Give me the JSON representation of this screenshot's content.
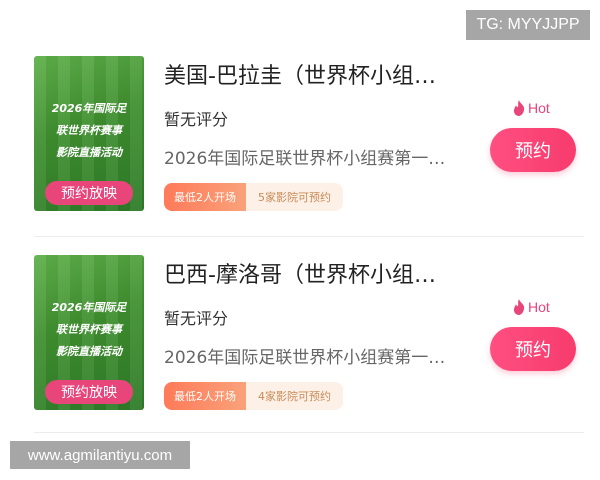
{
  "watermarks": {
    "tg": "TG: MYYJJPP",
    "site": "www.agmilantiyu.com"
  },
  "events": [
    {
      "poster_lines": [
        "2026年国际足",
        "联世界杯赛事",
        "影院直播活动"
      ],
      "poster_button": "预约放映",
      "title": "美国-巴拉圭（世界杯小组…",
      "rating": "暂无评分",
      "description": "2026年国际足联世界杯小组赛第一…",
      "min_tag": "最低2人开场",
      "cinema_tag": "5家影院可预约",
      "hot_label": "Hot",
      "book_label": "预约"
    },
    {
      "poster_lines": [
        "2026年国际足",
        "联世界杯赛事",
        "影院直播活动"
      ],
      "poster_button": "预约放映",
      "title": "巴西-摩洛哥（世界杯小组…",
      "rating": "暂无评分",
      "description": "2026年国际足联世界杯小组赛第一…",
      "min_tag": "最低2人开场",
      "cinema_tag": "4家影院可预约",
      "hot_label": "Hot",
      "book_label": "预约"
    }
  ],
  "colors": {
    "accent": "#e8457b",
    "button": "#f73b6d",
    "poster_green": "#3f8f2f"
  }
}
